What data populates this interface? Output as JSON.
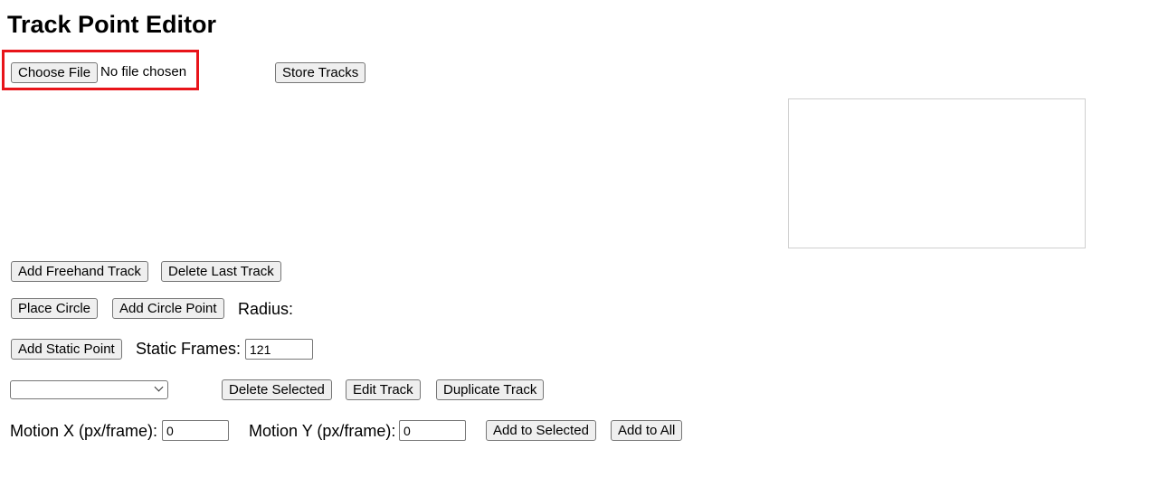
{
  "page": {
    "title": "Track Point Editor"
  },
  "file": {
    "choose_label": "Choose File",
    "status": "No file chosen"
  },
  "toolbar": {
    "store_label": "Store Tracks"
  },
  "tracks": {
    "add_freehand_label": "Add Freehand Track",
    "delete_last_label": "Delete Last Track"
  },
  "circle": {
    "place_label": "Place Circle",
    "add_point_label": "Add Circle Point",
    "radius_label": "Radius:"
  },
  "static": {
    "add_point_label": "Add Static Point",
    "frames_label": "Static Frames:",
    "frames_value": "121"
  },
  "selection": {
    "selected_value": "",
    "delete_label": "Delete Selected",
    "edit_label": "Edit Track",
    "duplicate_label": "Duplicate Track"
  },
  "motion": {
    "x_label": "Motion X (px/frame):",
    "x_value": "0",
    "y_label": "Motion Y (px/frame):",
    "y_value": "0",
    "add_selected_label": "Add to Selected",
    "add_all_label": "Add to All"
  },
  "colors": {
    "highlight": "#e8141a",
    "button_bg": "#efefef",
    "border": "#767676"
  }
}
